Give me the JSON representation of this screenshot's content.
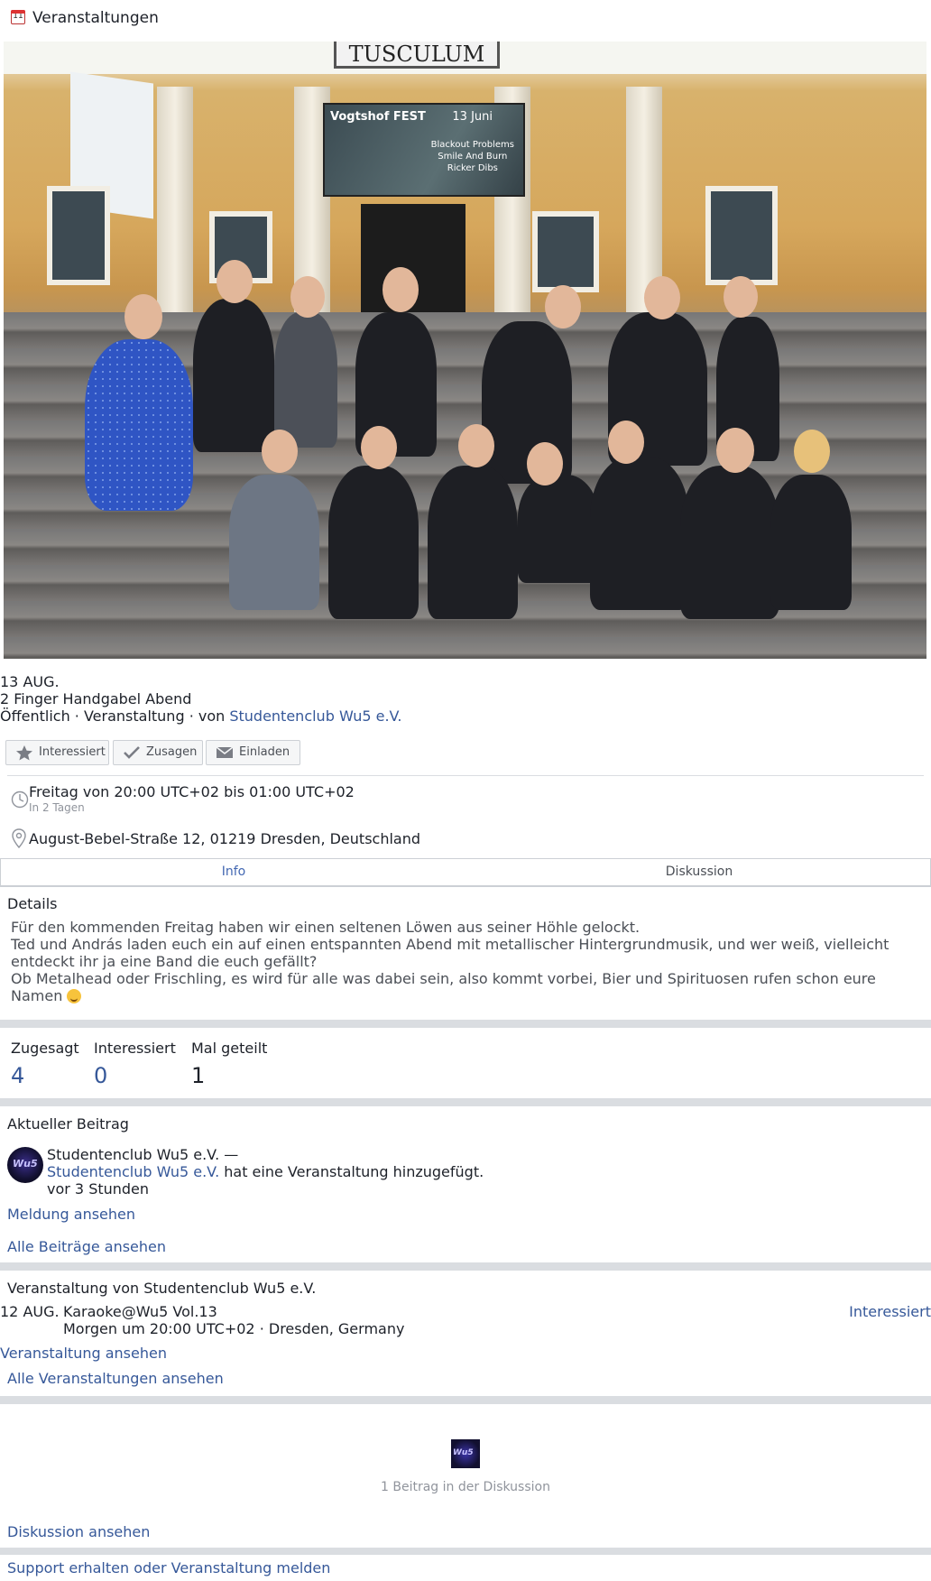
{
  "topbar": {
    "icon": "calendar-icon",
    "icon_day": "11",
    "title": "Veranstaltungen"
  },
  "event": {
    "date": "13 AUG.",
    "title": "2 Finger Handgabel Abend",
    "meta_prefix": "Öffentlich · Veranstaltung · von ",
    "host": "Studentenclub Wu5 e.V."
  },
  "actions": {
    "interested": "Interessiert",
    "going": "Zusagen",
    "invite": "Einladen"
  },
  "time": {
    "main": "Freitag von 20:00 UTC+02 bis 01:00 UTC+02",
    "relative": "In 2 Tagen"
  },
  "address": "August-Bebel-Straße 12, 01219 Dresden, Deutschland",
  "tabs": {
    "info": "Info",
    "discussion": "Diskussion"
  },
  "details": {
    "heading": "Details",
    "text": "Für den kommenden Freitag haben wir einen seltenen Löwen aus seiner Höhle gelockt.\nTed und András laden euch ein auf einen entspannten Abend mit metallischer Hintergrundmusik, und wer weiß, vielleicht entdeckt ihr ja eine Band die euch gefällt?\nOb Metalhead oder Frischling, es wird für alle was dabei sein, also kommt vorbei, Bier und Spirituosen rufen schon eure Namen"
  },
  "stats": {
    "going_label": "Zugesagt",
    "going_value": "4",
    "interested_label": "Interessiert",
    "interested_value": "0",
    "shared_label": "Mal geteilt",
    "shared_value": "1"
  },
  "recent_post": {
    "heading": "Aktueller Beitrag",
    "author": "Studentenclub Wu5 e.V. —",
    "actor_link": "Studentenclub Wu5 e.V.",
    "action": " hat eine Veranstaltung hinzugefügt.",
    "time": "vor 3 Stunden",
    "avatar_text": "Wu5",
    "view_post": "Meldung ansehen",
    "all_posts": "Alle Beiträge ansehen"
  },
  "host_events": {
    "heading": "Veranstaltung von Studentenclub Wu5 e.V.",
    "item": {
      "date": "12 AUG.",
      "title": "Karaoke@Wu5 Vol.13",
      "subtitle": "Morgen um 20:00 UTC+02 · Dresden, Germany",
      "interested": "Interessiert"
    },
    "view_event": "Veranstaltung ansehen",
    "all_events": "Alle Veranstaltungen ansehen"
  },
  "discussion": {
    "thumb_text": "Wu5",
    "count_text": "1 Beitrag in der Diskussion",
    "view": "Diskussion ansehen"
  },
  "footer_link": "Support erhalten oder Veranstaltung melden",
  "cover": {
    "building_sign": "TUSCULUM",
    "banner_title": "Vogtshof FEST",
    "banner_date": "13 Juni",
    "banner_bands": "Blackout Problems\nSmile And Burn\nRicker Dibs"
  },
  "colors": {
    "link": "#365899",
    "tab_active": "#4267b2",
    "separator": "#dadde1",
    "muted": "#90949c"
  }
}
